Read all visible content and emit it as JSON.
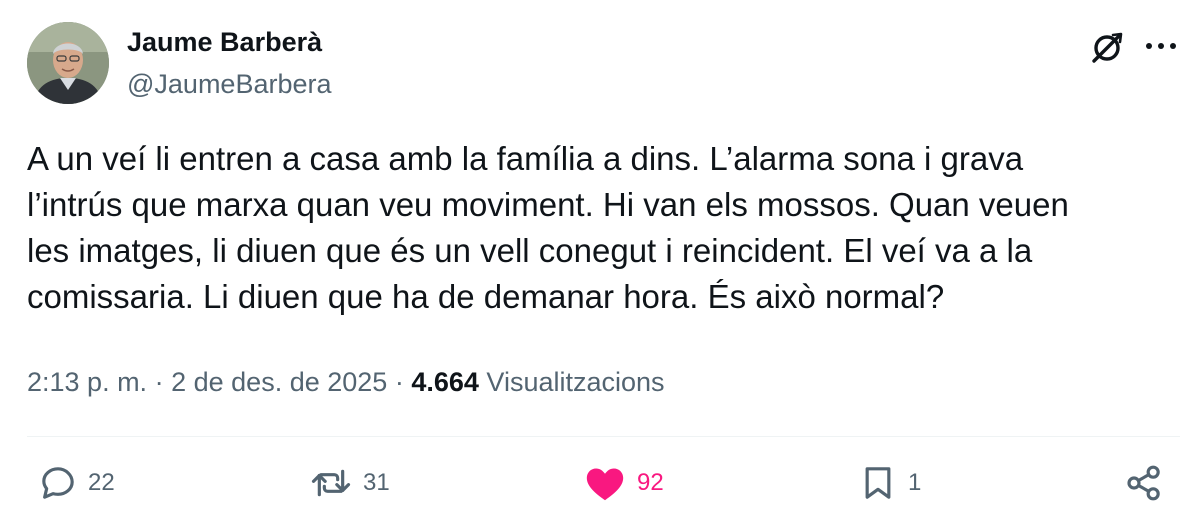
{
  "author": {
    "name": "Jaume Barberà",
    "handle": "@JaumeBarbera",
    "avatar": "avatar-photo"
  },
  "header_icons": [
    "grok-icon",
    "more-icon"
  ],
  "tweet": {
    "text_lines": [
      "A un veí li entren a casa amb la família a dins. L’alarma sona i grava",
      "l’intrús que marxa quan veu moviment. Hi van els mossos. Quan veuen",
      "les imatges, li diuen que és un vell conegut i reincident. El veí va a la",
      "comissaria. Li diuen que ha de demanar hora. És això normal?"
    ]
  },
  "meta": {
    "time": "2:13 p. m.",
    "separator": "·",
    "date": "2 de des. de 2025",
    "views_count": "4.664",
    "views_label": "Visualitzacions"
  },
  "actions": {
    "reply": {
      "icon": "reply-icon",
      "count": "22"
    },
    "retweet": {
      "icon": "retweet-icon",
      "count": "31"
    },
    "like": {
      "icon": "heart-icon",
      "count": "92",
      "liked": true
    },
    "bookmark": {
      "icon": "bookmark-icon",
      "count": "1"
    },
    "share": {
      "icon": "share-icon"
    }
  },
  "colors": {
    "text_primary": "#0f1419",
    "text_secondary": "#536471",
    "like_active": "#f91880",
    "divider": "#eff3f4"
  }
}
